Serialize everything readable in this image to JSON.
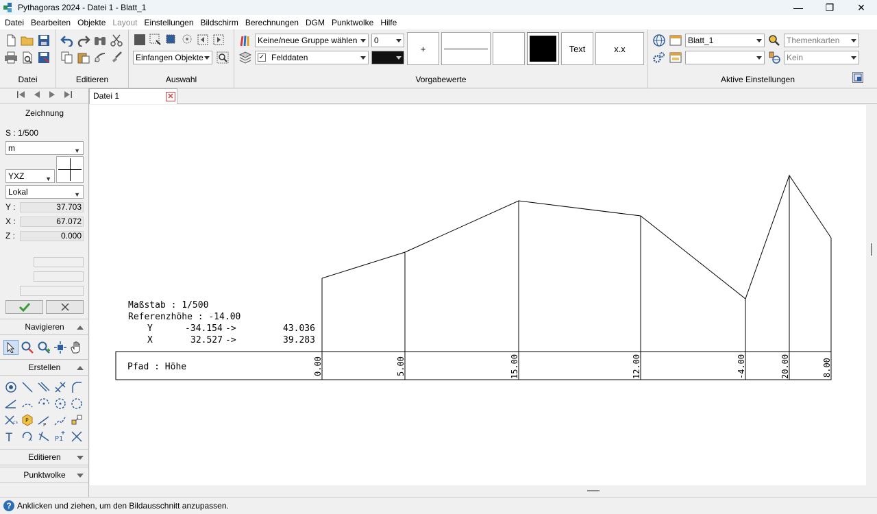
{
  "window": {
    "title": "Pythagoras 2024 - Datei 1 - Blatt_1",
    "minimize_glyph": "—",
    "maximize_glyph": "❐",
    "close_glyph": "✕"
  },
  "menu": [
    {
      "label": "Datei",
      "enabled": true
    },
    {
      "label": "Bearbeiten",
      "enabled": true
    },
    {
      "label": "Objekte",
      "enabled": true
    },
    {
      "label": "Layout",
      "enabled": false
    },
    {
      "label": "Einstellungen",
      "enabled": true
    },
    {
      "label": "Bildschirm",
      "enabled": true
    },
    {
      "label": "Berechnungen",
      "enabled": true
    },
    {
      "label": "DGM",
      "enabled": true
    },
    {
      "label": "Punktwolke",
      "enabled": true
    },
    {
      "label": "Hilfe",
      "enabled": true
    }
  ],
  "ribbon": {
    "groups": {
      "datei": "Datei",
      "editieren": "Editieren",
      "auswahl": "Auswahl",
      "vorgabewerte": "Vorgabewerte",
      "aktive": "Aktive Einstellungen"
    },
    "capture_combo": "Einfangen Objekte",
    "group_combo": "Keine/neue Gruppe wählen",
    "layer_combo_value": "0",
    "felddaten_label": "Felddaten",
    "felddaten_checked": true,
    "preset_plus": "+",
    "preset_text": "Text",
    "preset_xx": "x.x",
    "sheet_combo": "Blatt_1",
    "theme_combo": "Themenkarten",
    "kein_combo": "Kein",
    "empty_combo": ""
  },
  "left": {
    "zeichnung": "Zeichnung",
    "scale": "S : 1/500",
    "unit": "m",
    "axis_order": "YXZ",
    "coord_system": "Lokal",
    "y_label": "Y :",
    "y_value": "37.703",
    "x_label": "X :",
    "x_value": "67.072",
    "z_label": "Z :",
    "z_value": "0.000",
    "navigieren": "Navigieren",
    "erstellen": "Erstellen",
    "editieren": "Editieren",
    "punktwolke": "Punktwolke"
  },
  "tab": {
    "label": "Datei 1"
  },
  "drawing": {
    "scale_line": "Maßstab : 1/500",
    "ref_line": "Referenzhöhe : -14.00",
    "y_row": {
      "axis": "Y",
      "from": "-34.154",
      "arrow": "->",
      "to": "43.036"
    },
    "x_row": {
      "axis": "X",
      "from": "32.527",
      "arrow": "->",
      "to": "39.283"
    },
    "path_label": "Pfad : Höhe",
    "heights": [
      "0.00",
      "5.00",
      "15.00",
      "12.00",
      "-4.00",
      "20.00",
      "8.00"
    ]
  },
  "status": {
    "text": "Anklicken und ziehen, um den Bildausschnitt anzupassen."
  }
}
